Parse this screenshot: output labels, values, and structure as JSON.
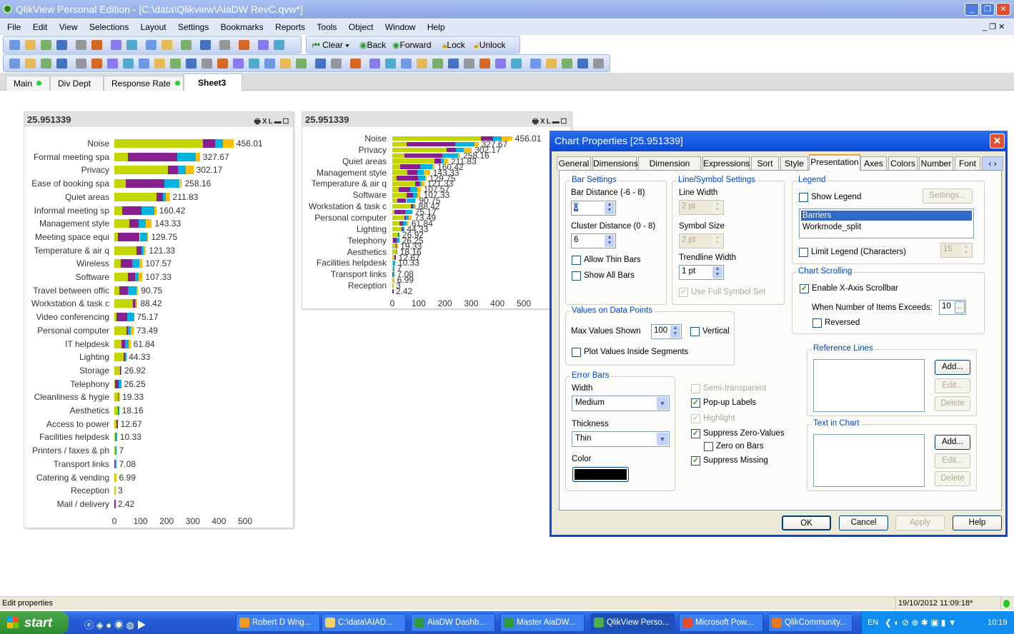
{
  "window": {
    "title": "QlikView Personal Edition - [C:\\data\\Qlikview\\AiaDW RevC.qvw*]",
    "minimize": "_",
    "restore": "❐",
    "close": "✕"
  },
  "menu": [
    "File",
    "Edit",
    "View",
    "Selections",
    "Layout",
    "Settings",
    "Bookmarks",
    "Reports",
    "Tools",
    "Object",
    "Window",
    "Help"
  ],
  "toolbar1": {
    "icons": [
      "new-icon",
      "open-icon",
      "reload-icon",
      "save-icon",
      "print-icon",
      "edit-script-icon",
      "reload-data-icon",
      "undo-icon",
      "redo-icon",
      "search-icon",
      "check-icon",
      "chart-wizard-icon",
      "favorite-icon",
      "edit-icon",
      "help-icon",
      "context-help-icon"
    ],
    "clear": "Clear",
    "back": "Back",
    "forward": "Forward",
    "lock": "Lock",
    "unlock": "Unlock"
  },
  "toolbar2": {
    "icons": [
      "new-sheet-icon",
      "promote-sheet-icon",
      "demote-sheet-icon",
      "sheet-props-icon",
      "listbox-icon",
      "statistics-box-icon",
      "multibox-icon",
      "table-box-icon",
      "chart-icon",
      "input-box-icon",
      "current-selections-icon",
      "button-icon",
      "text-object-icon",
      "line-arrow-icon",
      "slider-icon",
      "bookmark-icon",
      "search-object-icon",
      "container-icon",
      "custom-object-icon",
      "chart-wizard-icon",
      "format-painter-icon",
      "align-grid-icon",
      "align-left-icon",
      "align-center-icon",
      "align-right-icon",
      "align-bottom-icon",
      "align-middle-icon",
      "align-top-icon",
      "space-horizontal-icon",
      "space-vertical-icon",
      "space-icon",
      "distribute-icon",
      "user-icon",
      "report-icon",
      "edit-report-icon",
      "share-icon",
      "document-icon"
    ]
  },
  "tabs": [
    {
      "label": "Main",
      "dot": true
    },
    {
      "label": "Div Dept",
      "dot": false
    },
    {
      "label": "Response Rate",
      "dot": true
    },
    {
      "label": "Sheet3",
      "dot": false,
      "active": true
    }
  ],
  "chart_data": [
    {
      "type": "bar",
      "orientation": "horizontal",
      "stacked": true,
      "title": "25.951339",
      "caption_icons": [
        "print-icon",
        "excel-icon",
        "minimize-icon",
        "maximize-icon"
      ],
      "categories": [
        "Noise",
        "Formal meeting spa",
        "Privacy",
        "Ease of booking spa",
        "Quiet areas",
        "Informal meeting sp",
        "Management style",
        "Meeting space equi",
        "Temperature & air q",
        "Wireless",
        "Software",
        "Travel between offic",
        "Workstation & task c",
        "Video conferencing",
        "Personal computer",
        "IT helpdesk",
        "Lighting",
        "Storage",
        "Telephony",
        "Cleanliness & hygie",
        "Aesthetics",
        "Access to power",
        "Facilities helpdesk",
        "Printers / faxes & ph",
        "Transport links",
        "Catering & vending",
        "Reception",
        "Mail / delivery"
      ],
      "totals": [
        "456.01",
        "327.67",
        "302.17",
        "258.16",
        "211.83",
        "160.42",
        "143.33",
        "129.75",
        "121.33",
        "107.57",
        "107.33",
        "90.75",
        "88.42",
        "75.17",
        "73.49",
        "61.84",
        "44.33",
        "26.92",
        "26.25",
        "19.33",
        "18.16",
        "12.67",
        "10.33",
        "7",
        "7.08",
        "6.99",
        "3",
        "2.42"
      ],
      "series": [
        {
          "color": "#c3d600",
          "values": [
            338,
            53,
            206,
            45,
            161,
            29,
            57,
            15,
            86,
            25,
            53,
            18,
            70,
            7,
            46,
            27,
            35,
            22,
            4,
            14,
            15,
            8,
            2,
            2,
            1,
            2,
            3,
            0
          ]
        },
        {
          "color": "#86208e",
          "values": [
            46,
            187,
            37,
            146,
            25,
            76,
            37,
            82,
            18,
            43,
            25,
            35,
            8,
            41,
            5,
            14,
            6,
            2,
            13,
            3,
            1,
            4.67,
            2,
            2,
            1,
            2,
            0,
            2.42
          ]
        },
        {
          "color": "#00b3e0",
          "values": [
            32,
            72,
            30,
            59,
            10,
            47,
            25,
            28,
            8,
            27,
            16,
            33,
            5,
            27.17,
            11,
            13,
            3.33,
            2.92,
            9.25,
            0,
            2.16,
            0,
            6.33,
            3,
            5.08,
            0,
            0,
            0
          ]
        },
        {
          "color": "#fec000",
          "values": [
            40.01,
            15.67,
            29.17,
            8.16,
            15.83,
            8.42,
            24.33,
            4.75,
            9.33,
            12.57,
            13.33,
            4.75,
            5.42,
            0,
            11.49,
            7.84,
            0,
            0,
            0,
            2.33,
            0,
            0,
            0,
            0,
            0,
            2.99,
            0,
            0
          ]
        }
      ],
      "xticks": [
        "0",
        "100",
        "200",
        "300",
        "400",
        "500"
      ],
      "xlim": [
        0,
        500
      ],
      "grid": false,
      "legend": "none"
    },
    {
      "type": "bar",
      "orientation": "horizontal",
      "stacked": true,
      "title": "25.951339",
      "caption_icons": [
        "print-icon",
        "excel-icon",
        "minimize-icon",
        "maximize-icon"
      ],
      "categories_shown": [
        "Noise",
        "Privacy",
        "Quiet areas",
        "Management style",
        "Temperature & air q",
        "Software",
        "Workstation & task c",
        "Personal computer",
        "Lighting",
        "Telephony",
        "Aesthetics",
        "Facilities helpdesk",
        "Transport links",
        "Reception"
      ],
      "note_same_data_as": "chart 1",
      "xticks": [
        "0",
        "100",
        "200",
        "300",
        "400",
        "500"
      ],
      "xlim": [
        0,
        500
      ],
      "grid": false,
      "legend": "none"
    }
  ],
  "dialog": {
    "title": "Chart Properties [25.951339]",
    "tabs": [
      "General",
      "Dimensions",
      "Dimension Limits",
      "Expressions",
      "Sort",
      "Style",
      "Presentation",
      "Axes",
      "Colors",
      "Number",
      "Font"
    ],
    "active_tab": "Presentation",
    "bar_settings": {
      "title": "Bar Settings",
      "bar_distance_label": "Bar Distance (-6 - 8)",
      "bar_distance": "0",
      "cluster_distance_label": "Cluster Distance (0 - 8)",
      "cluster_distance": "6",
      "allow_thin_bars": "Allow Thin Bars",
      "show_all_bars": "Show All Bars"
    },
    "line_settings": {
      "title": "Line/Symbol Settings",
      "line_width_label": "Line Width",
      "line_width": "2 pt",
      "symbol_size_label": "Symbol Size",
      "symbol_size": "2 pt",
      "trendline_width_label": "Trendline Width",
      "trendline_width": "1 pt",
      "use_full_symbol_set": "Use Full Symbol Set"
    },
    "legend": {
      "title": "Legend",
      "show_legend": "Show Legend",
      "settings": "Settings...",
      "items": [
        "Barriers",
        "Workmode_split"
      ],
      "limit_legend": "Limit Legend (Characters)",
      "limit_value": "15"
    },
    "scrolling": {
      "title": "Chart Scrolling",
      "enable": "Enable X-Axis Scrollbar",
      "exceeds_label": "When Number of Items Exceeds:",
      "exceeds_value": "10",
      "more": "...",
      "reversed": "Reversed"
    },
    "values_on_points": {
      "title": "Values on Data Points",
      "max_label": "Max Values Shown",
      "max_value": "100",
      "vertical": "Vertical",
      "plot_inside": "Plot Values Inside Segments"
    },
    "error_bars": {
      "title": "Error Bars",
      "width_label": "Width",
      "width": "Medium",
      "thickness_label": "Thickness",
      "thickness": "Thin",
      "color_label": "Color",
      "color": "#000000"
    },
    "options": {
      "semi_transparent": "Semi-transparent",
      "popup_labels": "Pop-up Labels",
      "highlight": "Highlight",
      "suppress_zero": "Suppress Zero-Values",
      "zero_on_bars": "Zero on Bars",
      "suppress_missing": "Suppress Missing"
    },
    "reference_lines": {
      "title": "Reference Lines",
      "add": "Add...",
      "edit": "Edit...",
      "delete": "Delete"
    },
    "text_in_chart": {
      "title": "Text in Chart",
      "add": "Add...",
      "edit": "Edit...",
      "delete": "Delete"
    },
    "buttons": {
      "ok": "OK",
      "cancel": "Cancel",
      "apply": "Apply",
      "help": "Help"
    }
  },
  "status": {
    "text": "Edit properties",
    "datetime": "19/10/2012 11:09:18*"
  },
  "taskbar": {
    "start": "start",
    "items": [
      "Robert D Wrig...",
      "C:\\data\\AIAD...",
      "AiaDW Dashb...",
      "Master AiaDW...",
      "QlikView Perso...",
      "Microsoft Pow...",
      "QlikCommunity..."
    ],
    "item_colors": [
      "#f29a1b",
      "#f3d36b",
      "#2f9a3f",
      "#2f9a3f",
      "#4caf50",
      "#e04c2e",
      "#e8761c"
    ],
    "lang": "EN",
    "clock": "10:19"
  }
}
